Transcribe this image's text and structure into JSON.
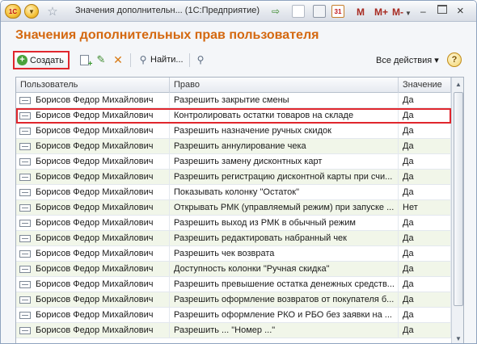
{
  "titlebar": {
    "logo": "1С",
    "title": "Значения дополнительн... (1С:Предприятие)",
    "calendar_day": "31",
    "m_buttons": [
      "M",
      "M+",
      "M-"
    ]
  },
  "page_title": "Значения дополнительных прав пользователя",
  "toolbar": {
    "create_label": "Создать",
    "find_label": "Найти...",
    "all_actions_label": "Все действия ▾",
    "help_label": "?"
  },
  "table": {
    "columns": [
      "Пользователь",
      "Право",
      "Значение"
    ],
    "rows": [
      {
        "user": "Борисов Федор Михайлович",
        "right": "Разрешить закрытие смены",
        "value": "Да"
      },
      {
        "user": "Борисов Федор Михайлович",
        "right": "Контролировать остатки товаров на складе",
        "value": "Да"
      },
      {
        "user": "Борисов Федор Михайлович",
        "right": "Разрешить назначение ручных скидок",
        "value": "Да"
      },
      {
        "user": "Борисов Федор Михайлович",
        "right": "Разрешить аннулирование чека",
        "value": "Да"
      },
      {
        "user": "Борисов Федор Михайлович",
        "right": "Разрешить замену дисконтных карт",
        "value": "Да"
      },
      {
        "user": "Борисов Федор Михайлович",
        "right": "Разрешить регистрацию дисконтной карты при счи...",
        "value": "Да"
      },
      {
        "user": "Борисов Федор Михайлович",
        "right": "Показывать колонку \"Остаток\"",
        "value": "Да"
      },
      {
        "user": "Борисов Федор Михайлович",
        "right": "Открывать РМК (управляемый режим) при запуске ...",
        "value": "Нет"
      },
      {
        "user": "Борисов Федор Михайлович",
        "right": "Разрешить выход из РМК в обычный режим",
        "value": "Да"
      },
      {
        "user": "Борисов Федор Михайлович",
        "right": "Разрешить редактировать набранный чек",
        "value": "Да"
      },
      {
        "user": "Борисов Федор Михайлович",
        "right": "Разрешить чек возврата",
        "value": "Да"
      },
      {
        "user": "Борисов Федор Михайлович",
        "right": "Доступность колонки \"Ручная скидка\"",
        "value": "Да"
      },
      {
        "user": "Борисов Федор Михайлович",
        "right": "Разрешить превышение остатка денежных средств...",
        "value": "Да"
      },
      {
        "user": "Борисов Федор Михайлович",
        "right": "Разрешить оформление возвратов от покупателя б...",
        "value": "Да"
      },
      {
        "user": "Борисов Федор Михайлович",
        "right": "Разрешить оформление РКО и РБО без заявки на ...",
        "value": "Да"
      },
      {
        "user": "Борисов Федор Михайлович",
        "right": "Разрешить ... \"Номер ...\"",
        "value": "Да"
      }
    ]
  }
}
